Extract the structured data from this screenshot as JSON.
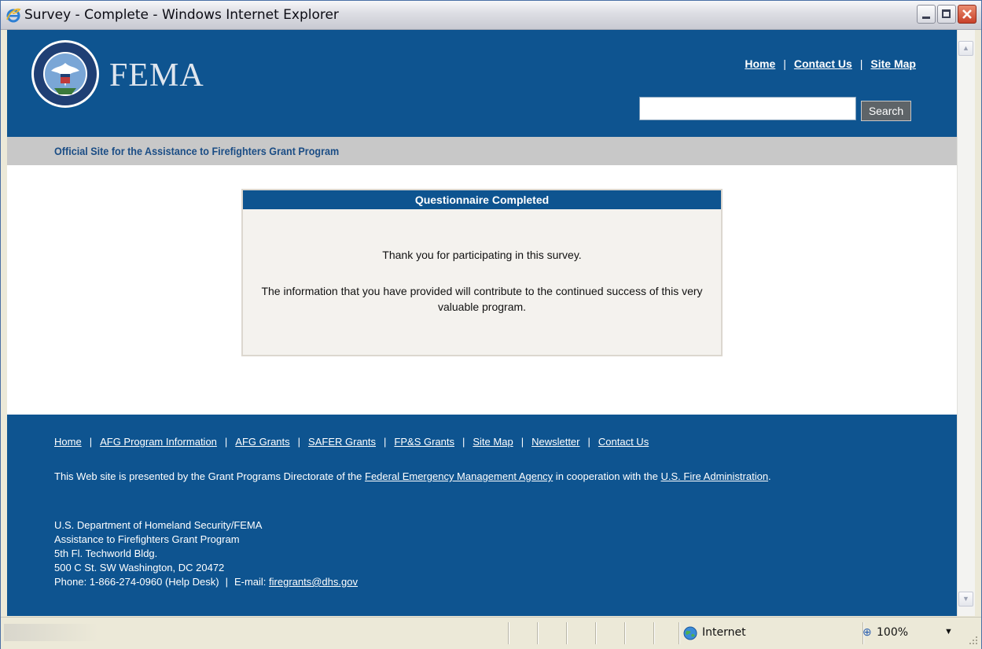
{
  "window": {
    "title": "Survey - Complete - Windows Internet Explorer"
  },
  "header": {
    "logo_text": "FEMA",
    "links": [
      "Home",
      "Contact Us",
      "Site Map"
    ],
    "search_placeholder": "",
    "search_button": "Search",
    "subtitle": "Official Site for the Assistance to Firefighters Grant Program"
  },
  "box": {
    "heading": "Questionnaire Completed",
    "thanks": "Thank you for participating in this survey.",
    "info": "The information that you have provided will contribute to the continued success of this very valuable program."
  },
  "footer": {
    "links": [
      "Home",
      "AFG Program Information",
      "AFG Grants",
      "SAFER Grants",
      "FP&S Grants",
      "Site Map",
      "Newsletter",
      "Contact Us"
    ],
    "note_prefix": "This Web site is presented by the Grant Programs Directorate of the ",
    "note_link1": "Federal Emergency Management Agency",
    "note_mid": " in cooperation with the ",
    "note_link2": "U.S. Fire Administration",
    "note_suffix": ".",
    "address": [
      "U.S. Department of Homeland Security/FEMA",
      "Assistance to Firefighters Grant Program",
      "5th Fl. Techworld Bldg.",
      "500 C St. SW Washington, DC 20472"
    ],
    "phone": "Phone: 1-866-274-0960 (Help Desk)",
    "email_label": "E-mail:",
    "email": "firegrants@dhs.gov"
  },
  "statusbar": {
    "zone": "Internet",
    "zoom": "100%"
  },
  "colors": {
    "fema_blue": "#0e5490",
    "subbar_gray": "#c8c8c8",
    "box_bg": "#f4f2ee"
  }
}
